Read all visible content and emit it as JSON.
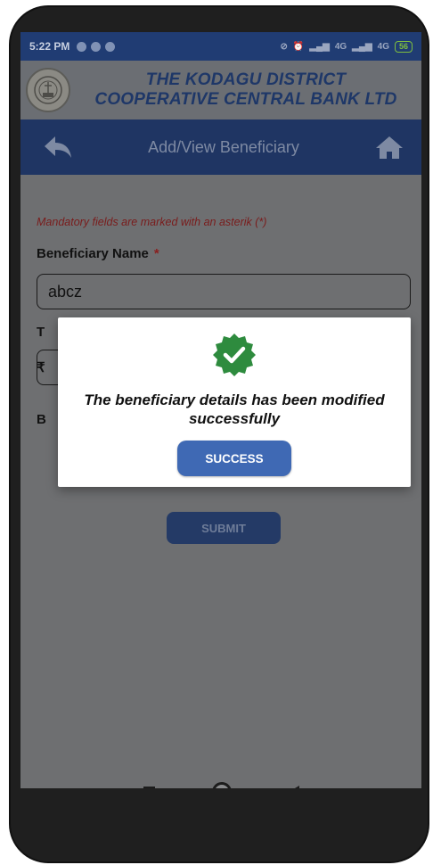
{
  "status_bar": {
    "time": "5:22 PM",
    "network_1": "4G",
    "network_2": "4G",
    "battery": "56"
  },
  "header": {
    "bank_name_line1": "THE KODAGU DISTRICT",
    "bank_name_line2": "COOPERATIVE CENTRAL BANK LTD",
    "logo_icon": "bank-emblem-icon"
  },
  "nav": {
    "title": "Add/View Beneficiary",
    "back_icon": "back-arrow-icon",
    "home_icon": "home-icon"
  },
  "form": {
    "mandatory_note": "Mandatory fields are marked with an asterik (*)",
    "beneficiary_name_label": "Beneficiary Name",
    "required_marker": "*",
    "beneficiary_name_value": "abcz",
    "hidden_label_fragment_1": "T",
    "hidden_label_fragment_2": "₹",
    "hidden_label_fragment_3": "B",
    "submit_label": "SUBMIT"
  },
  "dialog": {
    "icon": "verified-check-badge-icon",
    "message": "The beneficiary details has been modified successfully",
    "button_label": "SUCCESS",
    "accent_color": "#2e8b3e",
    "button_color": "#3f69b4"
  },
  "colors": {
    "primary": "#203c73",
    "header_bg": "#6b6e73",
    "overlay_bg": "#6e6f71"
  }
}
